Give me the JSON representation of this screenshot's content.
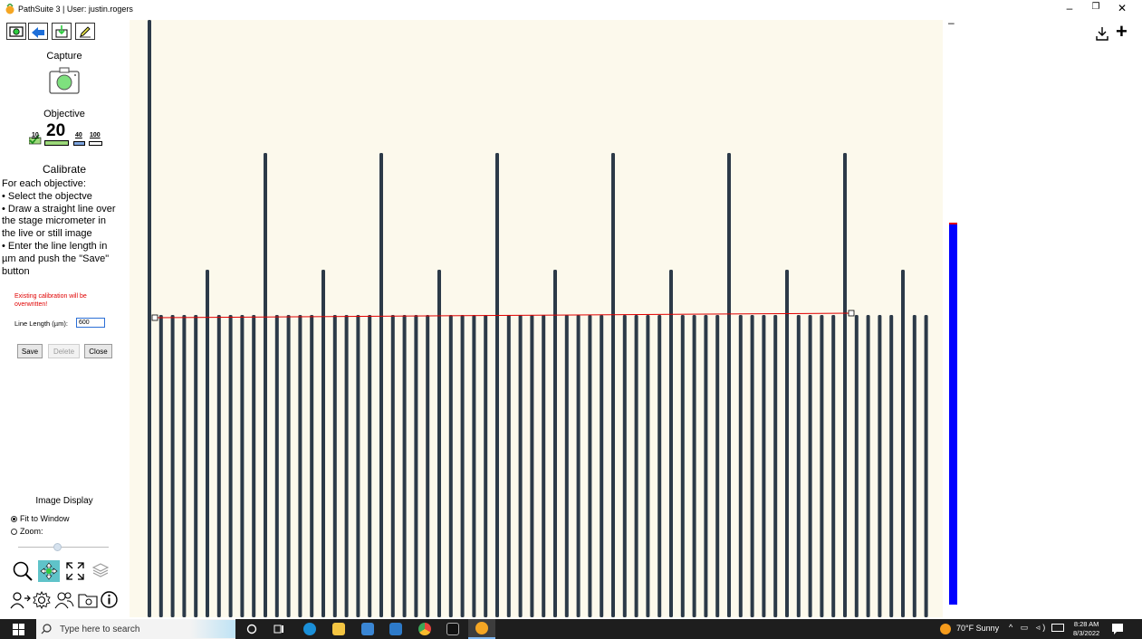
{
  "window": {
    "title": "PathSuite 3 | User: justin.rogers",
    "controls": [
      "–",
      "❐",
      "✕"
    ]
  },
  "toolbar": {
    "tools": [
      "camera-tool",
      "share-tool",
      "download-tool",
      "pencil-tool"
    ]
  },
  "capture": {
    "title": "Capture"
  },
  "objective": {
    "title": "Objective",
    "selected": "20",
    "options": [
      "10",
      "20",
      "40",
      "100"
    ]
  },
  "calibrate": {
    "title": "Calibrate",
    "instructions": "For each objective:\n• Select the objectve\n• Draw a straight line over the stage micrometer in the live or still image\n• Enter the line length in µm and push the \"Save\" button",
    "warning": "Existing calibration will be overwritten!",
    "line_length_label": "Line Length (µm):",
    "line_length_value": "600",
    "save_label": "Save",
    "delete_label": "Delete",
    "close_label": "Close"
  },
  "image_display": {
    "title": "Image Display",
    "fit_label": "Fit to Window",
    "zoom_label": "Zoom:",
    "fit_selected": true
  },
  "right_panel": {
    "minimize": "–",
    "plus": "+"
  },
  "taskbar": {
    "search_placeholder": "Type here to search",
    "weather": "70°F  Sunny",
    "time": "8:28 AM",
    "date": "8/3/2022"
  },
  "colors": {
    "scale_bar": "#0000ff",
    "measure_line": "#e00000",
    "micrometer_tick": "#2c3a48",
    "image_bg": "#fcf9ec"
  }
}
